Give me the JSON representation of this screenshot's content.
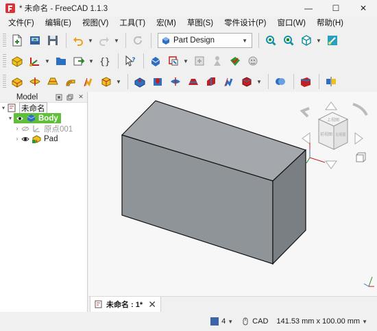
{
  "window": {
    "title": "* 未命名 - FreeCAD 1.1.3",
    "minimize": "—",
    "maximize": "☐",
    "close": "✕"
  },
  "menu": [
    "文件(F)",
    "编辑(E)",
    "视图(V)",
    "工具(T)",
    "宏(M)",
    "草图(S)",
    "零件设计(P)",
    "窗口(W)",
    "帮助(H)"
  ],
  "toolbar": {
    "workbench": "Part Design"
  },
  "model_panel": {
    "title": "Model",
    "tree": {
      "document": "未命名",
      "body": "Body",
      "origin": "原点001",
      "pad": "Pad"
    }
  },
  "navcube": {
    "top_label": "上视图",
    "front_label": "前视图",
    "right_label": "右视图"
  },
  "document_tab": {
    "label": "未命名 : 1*"
  },
  "statusbar": {
    "layer": "4",
    "nav_style": "CAD",
    "dimensions": "141.53 mm x 100.00 mm"
  },
  "colors": {
    "selection_green": "#5fbf3a",
    "solid_face_front": "#8f9498",
    "solid_face_top": "#a4a8ac",
    "solid_face_side": "#7a7f84",
    "accent_blue": "#3a66a8"
  }
}
